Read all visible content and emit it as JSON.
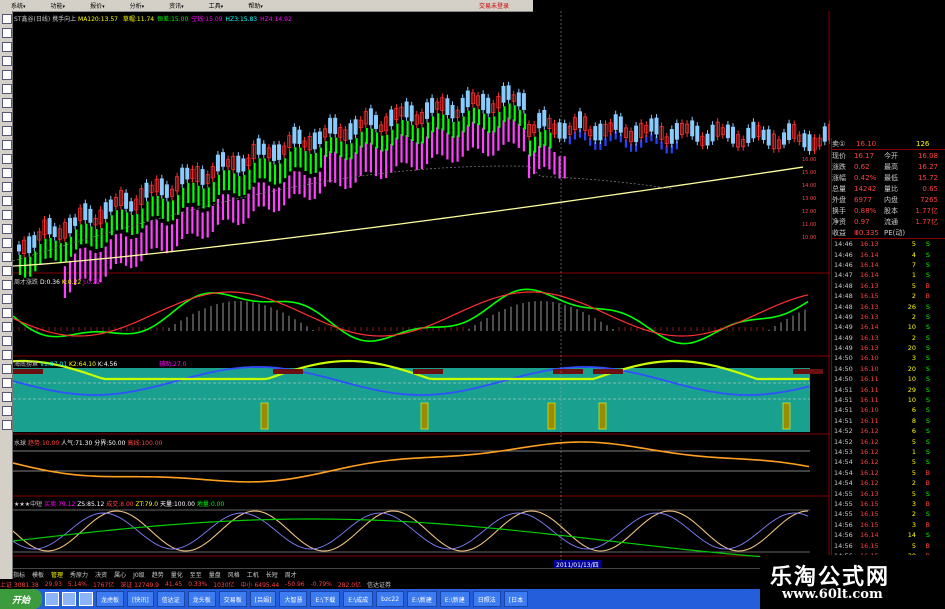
{
  "menu": {
    "items": [
      "系统",
      "功能",
      "报价",
      "分析",
      "资讯",
      "工具",
      "帮助"
    ],
    "right_text": "交易未登录"
  },
  "panels": {
    "main": {
      "title": "ST鑫谷(日线)",
      "indicator": "携手向上",
      "ma_text": "MA120:13.57",
      "values": [
        "草帽:11.74",
        "恒差:15.00",
        "空线:15.09",
        "HZ3:15.83",
        "HZ4:14.92"
      ],
      "value_colors": [
        "#ff0",
        "#0f0",
        "#f0f",
        "#0ff",
        "#f0f"
      ],
      "price_labels": [
        "16.00",
        "15.00",
        "14.00",
        "13.00",
        "12.00",
        "11.00",
        "10.00"
      ]
    },
    "p2": {
      "title": "周才涨跌",
      "values": [
        "D:0.36",
        "K:0.22",
        "J:0.22"
      ]
    },
    "p3": {
      "title": "海底捞鱼",
      "values": [
        "V1:87.01",
        "K2:64.10",
        "K:4.56"
      ],
      "extra": "辅助:27.0"
    },
    "p4": {
      "title": "水球",
      "values": [
        "趋势:10.00",
        "人气:71.30",
        "分界:50.00",
        "高线:100.00"
      ]
    },
    "p5": {
      "title": "★★★中短",
      "values": [
        "买卖:79.12",
        "ZS:85.12",
        "成交:8.00",
        "ZT:79.0"
      ],
      "extra": [
        "天量:100.00",
        "地量:0.00"
      ]
    }
  },
  "date_label": "2011/01/13/四",
  "quote": {
    "sell1": {
      "label": "卖①",
      "price": "16.10",
      "vol": "126"
    },
    "rows": [
      {
        "a": "现价",
        "b": "16.17",
        "c": "今开",
        "d": "16.08"
      },
      {
        "a": "涨跌",
        "b": "0.62",
        "c": "最高",
        "d": "16.27"
      },
      {
        "a": "涨幅",
        "b": "0.42%",
        "c": "最低",
        "d": "15.72"
      },
      {
        "a": "总量",
        "b": "14242",
        "c": "量比",
        "d": "0.65"
      },
      {
        "a": "外盘",
        "b": "6977",
        "c": "内盘",
        "d": "7265"
      },
      {
        "a": "换手",
        "b": "0.88%",
        "c": "股本",
        "d": "1.77亿"
      },
      {
        "a": "净资",
        "b": "0.97",
        "c": "流通",
        "d": "1.77亿"
      },
      {
        "a": "收益",
        "b": "Ⅲ0.335",
        "c": "PE(动)",
        "d": ""
      }
    ],
    "ticks": [
      [
        "14:46",
        "16.13",
        "5",
        "S"
      ],
      [
        "14:46",
        "16.14",
        "4",
        "S"
      ],
      [
        "14:46",
        "16.14",
        "7",
        "S"
      ],
      [
        "14:47",
        "16.14",
        "1",
        "S"
      ],
      [
        "14:48",
        "16.13",
        "5",
        "B"
      ],
      [
        "14:48",
        "16.15",
        "2",
        "B"
      ],
      [
        "14:48",
        "16.13",
        "26",
        "S"
      ],
      [
        "14:49",
        "16.13",
        "2",
        "S"
      ],
      [
        "14:49",
        "16.14",
        "10",
        "S"
      ],
      [
        "14:49",
        "16.13",
        "2",
        "S"
      ],
      [
        "14:49",
        "16.13",
        "20",
        "S"
      ],
      [
        "14:50",
        "16.10",
        "3",
        "S"
      ],
      [
        "14:50",
        "16.10",
        "20",
        "S"
      ],
      [
        "14:50",
        "16.11",
        "10",
        "S"
      ],
      [
        "14:51",
        "16.11",
        "29",
        "S"
      ],
      [
        "14:51",
        "16.11",
        "10",
        "S"
      ],
      [
        "14:51",
        "16.10",
        "6",
        "S"
      ],
      [
        "14:51",
        "16.11",
        "8",
        "S"
      ],
      [
        "14:52",
        "16.12",
        "6",
        "S"
      ],
      [
        "14:52",
        "16.12",
        "5",
        "S"
      ],
      [
        "14:53",
        "16.12",
        "1",
        "S"
      ],
      [
        "14:54",
        "16.12",
        "5",
        "S"
      ],
      [
        "14:54",
        "16.12",
        "5",
        "B"
      ],
      [
        "14:54",
        "16.12",
        "2",
        "B"
      ],
      [
        "14:55",
        "16.13",
        "5",
        "S"
      ],
      [
        "14:55",
        "16.15",
        "3",
        "B"
      ],
      [
        "14:55",
        "16.15",
        "2",
        "S"
      ],
      [
        "14:56",
        "16.15",
        "3",
        "B"
      ],
      [
        "14:56",
        "16.14",
        "14",
        "S"
      ],
      [
        "14:56",
        "16.15",
        "5",
        "B"
      ],
      [
        "14:56",
        "16.15",
        "30",
        "B"
      ]
    ]
  },
  "tabs": [
    "指标",
    "模板",
    "管理",
    "秀原力",
    "决资",
    "属心",
    "J0级",
    "趋势",
    "量化",
    "至至",
    "量盘",
    "风格",
    "工机",
    "长短",
    "周才"
  ],
  "ticker": [
    "上证 3081.38",
    "29.93",
    "5.14%",
    "1767亿",
    "深证 12749.9",
    "41.45",
    "0.33%",
    "1030亿",
    "中小 6495.44",
    "-50.96",
    "-0.79%",
    "282.0亿",
    "信达证券"
  ],
  "taskbar": {
    "start": "开始",
    "items": [
      "龙虎板",
      "[快讯]",
      "信达证",
      "龙头板",
      "交易板",
      "[吕娟]",
      "大智慧",
      "E:\\下载",
      "E:\\成成",
      "bzc22",
      "E:\\新建",
      "E:\\新建",
      "日照法",
      "[日本"
    ]
  },
  "watermark": {
    "line1": "乐淘公式网",
    "line2": "www.60lt.com"
  },
  "colors": {
    "up": "#ff3030",
    "down": "#00ff00",
    "ma": "#ffffa0",
    "magenta": "#ff40ff",
    "teal": "#1aa08f"
  }
}
